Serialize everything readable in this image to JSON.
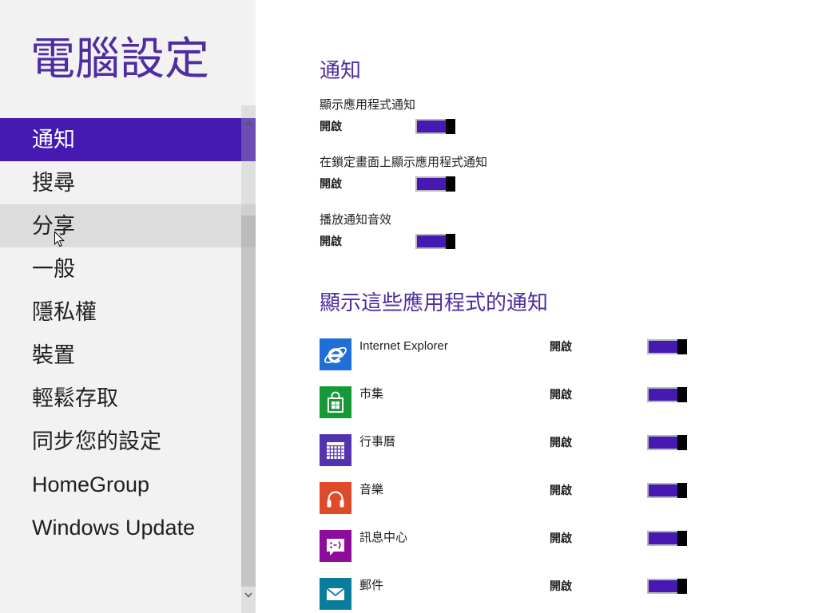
{
  "colors": {
    "accent": "#4519b2",
    "heading": "#4f2c9f",
    "nav_hover": "#dcdcdc"
  },
  "app": {
    "title": "電腦設定"
  },
  "nav": {
    "items": [
      {
        "label": "通知",
        "selected": true
      },
      {
        "label": "搜尋"
      },
      {
        "label": "分享",
        "hovered": true
      },
      {
        "label": "一般"
      },
      {
        "label": "隱私權"
      },
      {
        "label": "裝置"
      },
      {
        "label": "輕鬆存取"
      },
      {
        "label": "同步您的設定"
      },
      {
        "label": "HomeGroup"
      },
      {
        "label": "Windows Update"
      }
    ]
  },
  "notifications": {
    "heading": "通知",
    "settings": [
      {
        "label": "顯示應用程式通知",
        "status": "開啟",
        "on": true
      },
      {
        "label": "在鎖定畫面上顯示應用程式通知",
        "status": "開啟",
        "on": true
      },
      {
        "label": "播放通知音效",
        "status": "開啟",
        "on": true
      }
    ]
  },
  "app_notifications": {
    "heading": "顯示這些應用程式的通知",
    "apps": [
      {
        "name": "Internet Explorer",
        "icon": "internet-explorer-icon",
        "tile_color": "#1f6fd6",
        "status": "開啟",
        "on": true
      },
      {
        "name": "市集",
        "icon": "store-icon",
        "tile_color": "#169a38",
        "status": "開啟",
        "on": true
      },
      {
        "name": "行事曆",
        "icon": "calendar-icon",
        "tile_color": "#5433b0",
        "status": "開啟",
        "on": true
      },
      {
        "name": "音樂",
        "icon": "headphones-icon",
        "tile_color": "#de4a2a",
        "status": "開啟",
        "on": true
      },
      {
        "name": "訊息中心",
        "icon": "messaging-icon",
        "tile_color": "#8e0c9c",
        "status": "開啟",
        "on": true
      },
      {
        "name": "郵件",
        "icon": "mail-icon",
        "tile_color": "#0b7d9c",
        "status": "開啟",
        "on": true
      }
    ]
  }
}
